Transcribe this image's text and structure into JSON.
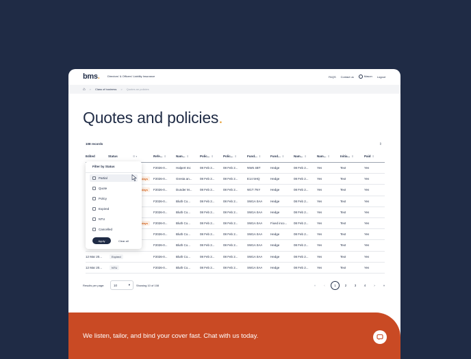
{
  "header": {
    "logo_text": "bms",
    "logo_dot": ".",
    "product": "Directors' & Officers' Liability Insurance",
    "faqs": "FAQS",
    "contact": "Contact us",
    "user": "Mason",
    "logout": "Logout"
  },
  "breadcrumb": {
    "sep": ">",
    "item1": "Class of business",
    "item2": "Quotes an policies"
  },
  "page": {
    "title": "Quotes and policies",
    "title_dot": ".",
    "records": "108 records"
  },
  "table": {
    "headers": [
      "Edited",
      "Status",
      "Refe...",
      "Nam...",
      "Polic...",
      "Polic...",
      "Fund...",
      "Fund...",
      "Nam...",
      "Nam...",
      "Initia...",
      "Paid"
    ],
    "rows": [
      {
        "edited": "",
        "status": "",
        "ref": "F2026-0...",
        "name": "Halpert Inc",
        "p1": "08 Feb 2...",
        "p2": "08 Feb 2...",
        "f1": "NW6 4BT",
        "f2": "Hedge",
        "n1": "08 Feb 2...",
        "n2": "Yes",
        "init": "Text",
        "paid": "Yes"
      },
      {
        "edited": "",
        "status": "days",
        "ref": "F2026-0...",
        "name": "Gresta an...",
        "p1": "08 Feb 2...",
        "p2": "08 Feb 2...",
        "f1": "E14 5HQ",
        "f2": "Hedge",
        "n1": "08 Feb 2...",
        "n2": "Yes",
        "init": "Text",
        "paid": "Yes"
      },
      {
        "edited": "",
        "status": "days",
        "ref": "F2026-0...",
        "name": "Dunder M...",
        "p1": "08 Feb 2...",
        "p2": "08 Feb 2...",
        "f1": "W1T 7NY",
        "f2": "Hedge",
        "n1": "08 Feb 2...",
        "n2": "Yes",
        "init": "Text",
        "paid": "Yes"
      },
      {
        "edited": "",
        "status": "",
        "ref": "F2026-0...",
        "name": "Bluth Co...",
        "p1": "08 Feb 2...",
        "p2": "08 Feb 2...",
        "f1": "SW1A 0AA",
        "f2": "Hedge",
        "n1": "08 Feb 2...",
        "n2": "Yes",
        "init": "Text",
        "paid": "Yes"
      },
      {
        "edited": "",
        "status": "",
        "ref": "F2026-0...",
        "name": "Bluth Co...",
        "p1": "08 Feb 2...",
        "p2": "08 Feb 2...",
        "f1": "SW1A 0AA",
        "f2": "Hedge",
        "n1": "08 Feb 2...",
        "n2": "Yes",
        "init": "Text",
        "paid": "Yes"
      },
      {
        "edited": "",
        "status": "days",
        "ref": "F2026-0...",
        "name": "Bluth Co...",
        "p1": "08 Feb 2...",
        "p2": "08 Feb 2...",
        "f1": "SW1A 0AA",
        "f2": "Fixed inco...",
        "n1": "08 Feb 2...",
        "n2": "Yes",
        "init": "Text",
        "paid": "Yes"
      },
      {
        "edited": "",
        "status": "",
        "ref": "F2026-0...",
        "name": "Bluth Co...",
        "p1": "08 Feb 2...",
        "p2": "08 Feb 2...",
        "f1": "SW1A 0AA",
        "f2": "Hedge",
        "n1": "08 Feb 2...",
        "n2": "Yes",
        "init": "Text",
        "paid": "Yes"
      },
      {
        "edited": "",
        "status": "",
        "ref": "F2026-0...",
        "name": "Bluth Co...",
        "p1": "08 Feb 2...",
        "p2": "08 Feb 2...",
        "f1": "SW1A 0AA",
        "f2": "Hedge",
        "n1": "08 Feb 2...",
        "n2": "Yes",
        "init": "Text",
        "paid": "Yes"
      },
      {
        "edited": "12 Mar 20...",
        "status": "Expired",
        "ref": "F2026-0...",
        "name": "Bluth Co...",
        "p1": "08 Feb 2...",
        "p2": "08 Feb 2...",
        "f1": "SW1A 0AA",
        "f2": "Hedge",
        "n1": "08 Feb 2...",
        "n2": "Yes",
        "init": "Text",
        "paid": "Yes"
      },
      {
        "edited": "12 Mar 20...",
        "status": "NTU",
        "ref": "F2026-0...",
        "name": "Bluth Co...",
        "p1": "08 Feb 2...",
        "p2": "08 Feb 2...",
        "f1": "SW1A 0AA",
        "f2": "Hedge",
        "n1": "08 Feb 2...",
        "n2": "Yes",
        "init": "Text",
        "paid": "Yes"
      }
    ]
  },
  "filter": {
    "title": "Filter by Status",
    "options": [
      "Partial",
      "Quote",
      "Policy",
      "Expired",
      "NTU",
      "Cancelled"
    ],
    "apply": "Apply",
    "clear": "Clear all"
  },
  "pagination": {
    "per_page_label": "Results per page:",
    "per_page_value": "10",
    "showing": "Showing 10 of 108",
    "first": "«",
    "prev": "‹",
    "pages": [
      "1",
      "2",
      "3",
      "4"
    ],
    "next": "›",
    "last": "»"
  },
  "footer": {
    "text": "We listen, tailor, and bind your cover fast. Chat with us today."
  },
  "colors": {
    "navy": "#1f2b45",
    "accent": "#e8a33c",
    "footer": "#c94a24",
    "warn": "#d9661f"
  }
}
